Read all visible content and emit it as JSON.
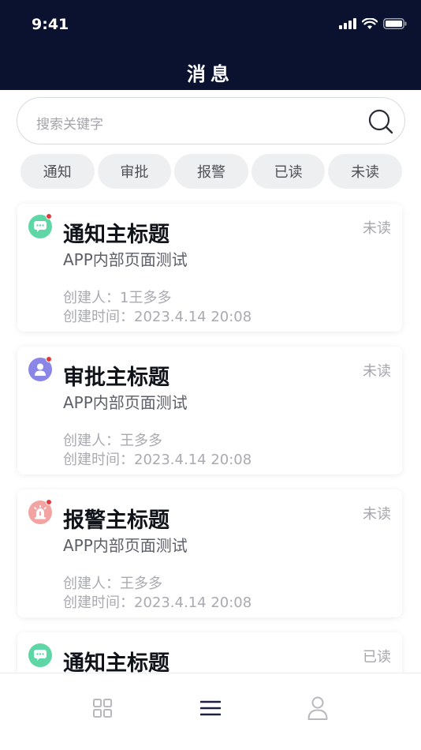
{
  "status_bar": {
    "time": "9:41"
  },
  "header": {
    "title": "消息"
  },
  "search": {
    "placeholder": "搜索关键字"
  },
  "filters": [
    "通知",
    "审批",
    "报警",
    "已读",
    "未读"
  ],
  "messages": [
    {
      "type": "notification",
      "title": "通知主标题",
      "status": "未读",
      "subtitle": "APP内部页面测试",
      "creator": "创建人：1王多多",
      "created_time": "创建时间：2023.4.14 20:08",
      "icon": "chat-bubble-icon",
      "color": "#5fd6a6",
      "unread_dot": true
    },
    {
      "type": "approval",
      "title": "审批主标题",
      "status": "未读",
      "subtitle": "APP内部页面测试",
      "creator": "创建人：王多多",
      "created_time": "创建时间：2023.4.14 20:08",
      "icon": "person-icon",
      "color": "#8a86e8",
      "unread_dot": true
    },
    {
      "type": "alarm",
      "title": "报警主标题",
      "status": "未读",
      "subtitle": "APP内部页面测试",
      "creator": "创建人：王多多",
      "created_time": "创建时间：2023.4.14 20:08",
      "icon": "alarm-light-icon",
      "color": "#f4a3a3",
      "unread_dot": true
    },
    {
      "type": "notification",
      "title": "通知主标题",
      "status": "已读",
      "icon": "chat-bubble-icon",
      "color": "#5fd6a6",
      "unread_dot": false
    }
  ],
  "tabbar": {
    "items": [
      {
        "icon": "grid-icon",
        "active": false
      },
      {
        "icon": "menu-icon",
        "active": true
      },
      {
        "icon": "user-icon",
        "active": false
      }
    ]
  },
  "colors": {
    "header_bg": "#0b1230",
    "active_tab": "#1c2140",
    "inactive_tab": "#b7b9be",
    "unread_dot": "#e23a3a"
  }
}
